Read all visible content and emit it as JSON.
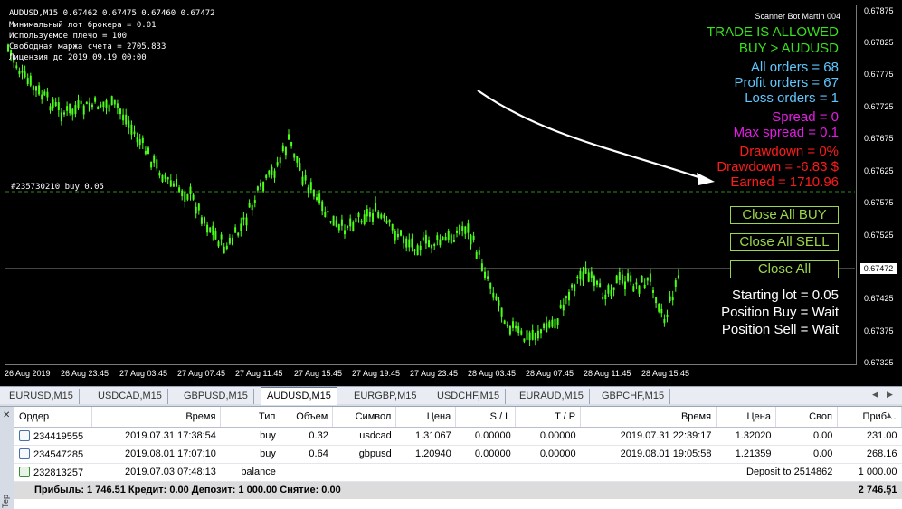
{
  "chart": {
    "symbol_info": "AUDUSD,M15  0.67462 0.67475 0.67460 0.67472",
    "info_lines": [
      "Минимальный лот брокера  =  0.01",
      "Используемое плечо  =  100",
      "Свободная маржа счета = 2705.833",
      "Лицензия до 2019.09.19 00:00"
    ],
    "order_line_label": "#235730210 buy 0.05",
    "bot_name": "Scanner Bot Martin 004",
    "colors": {
      "candle": "#4cff1a",
      "trade_allowed": "#37e31a",
      "orders": "#5ec8ff",
      "spread": "#e41ce4",
      "drawdown": "#ff1a1a",
      "button": "#9bd64a",
      "status": "#ffffff"
    },
    "panel": {
      "trade_status": "TRADE IS ALLOWED",
      "buy_line": "BUY > AUDUSD",
      "all_orders": "All orders = 68",
      "profit_orders": "Profit orders = 67",
      "loss_orders": "Loss orders = 1",
      "spread": "Spread =  0",
      "max_spread": "Max spread = 0.1",
      "drawdown_pct": "Drawdown  = 0%",
      "drawdown_usd": "Drawdown = -6.83 $",
      "earned": "Earned = 1710.96",
      "btn_close_buy": "Close All BUY",
      "btn_close_sell": "Close All SELL",
      "btn_close_all": "Close All",
      "starting_lot": "Starting lot = 0.05",
      "position_buy": "Position Buy  = Wait",
      "position_sell": "Position Sell = Wait"
    },
    "price_axis": [
      "0.67875",
      "0.67825",
      "0.67775",
      "0.67725",
      "0.67675",
      "0.67625",
      "0.67575",
      "0.67525",
      "0.67472",
      "0.67425",
      "0.67375",
      "0.67325"
    ],
    "current_price": "0.67472",
    "time_axis": [
      "26 Aug 2019",
      "26 Aug 23:45",
      "27 Aug 03:45",
      "27 Aug 07:45",
      "27 Aug 11:45",
      "27 Aug 15:45",
      "27 Aug 19:45",
      "27 Aug 23:45",
      "28 Aug 03:45",
      "28 Aug 07:45",
      "28 Aug 11:45",
      "28 Aug 15:45"
    ]
  },
  "tabs": [
    "EURUSD,M15",
    "USDCAD,M15",
    "GBPUSD,M15",
    "AUDUSD,M15",
    "EURGBP,M15",
    "USDCHF,M15",
    "EURAUD,M15",
    "GBPCHF,M15"
  ],
  "active_tab": "AUDUSD,M15",
  "terminal": {
    "side_label": "Тер",
    "columns": [
      "Ордер",
      "Время",
      "Тип",
      "Объем",
      "Символ",
      "Цена",
      "S / L",
      "T / P",
      "Время",
      "Цена",
      "Своп",
      "Приб…"
    ],
    "rows": [
      {
        "order": "234419555",
        "time": "2019.07.31 17:38:54",
        "type": "buy",
        "volume": "0.32",
        "symbol": "usdcad",
        "price": "1.31067",
        "sl": "0.00000",
        "tp": "0.00000",
        "close_time": "2019.07.31 22:39:17",
        "close_price": "1.32020",
        "swap": "0.00",
        "profit": "231.00"
      },
      {
        "order": "234547285",
        "time": "2019.08.01 17:07:10",
        "type": "buy",
        "volume": "0.64",
        "symbol": "gbpusd",
        "price": "1.20940",
        "sl": "0.00000",
        "tp": "0.00000",
        "close_time": "2019.08.01 19:05:58",
        "close_price": "1.21359",
        "swap": "0.00",
        "profit": "268.16"
      },
      {
        "order": "232813257",
        "time": "2019.07.03 07:48:13",
        "type": "balance",
        "comment": "Deposit to 2514862",
        "profit": "1 000.00"
      }
    ],
    "total_text": "Прибыль: 1 746.51  Кредит: 0.00  Депозит: 1 000.00  Снятие: 0.00",
    "total_value": "2 746.51"
  }
}
